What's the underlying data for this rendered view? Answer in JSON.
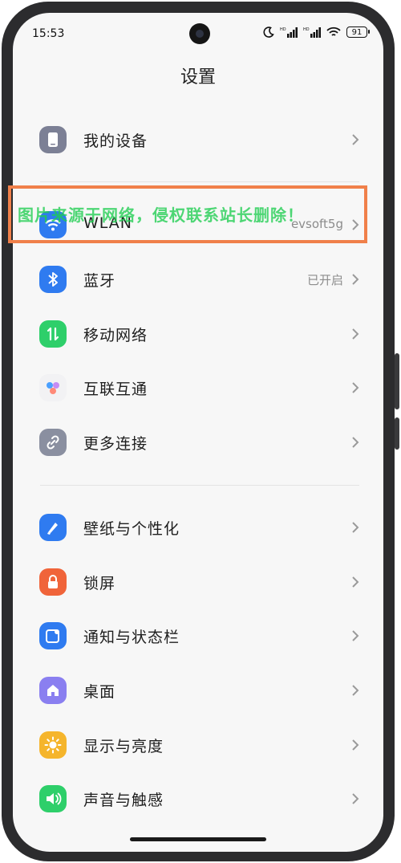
{
  "status_bar": {
    "time": "15:53",
    "signal_tag": "HD",
    "battery": "91"
  },
  "page": {
    "title": "设置"
  },
  "items": [
    {
      "label": "我的设备",
      "value": "",
      "icon": "phone-icon",
      "color": "#7c8095"
    },
    {
      "label": "WLAN",
      "value": "evsoft5g",
      "icon": "wifi-icon",
      "color": "#2f7bf0"
    },
    {
      "label": "蓝牙",
      "value": "已开启",
      "icon": "bluetooth-icon",
      "color": "#2f7bf0"
    },
    {
      "label": "移动网络",
      "value": "",
      "icon": "mobile-data-icon",
      "color": "#2ecf6a"
    },
    {
      "label": "互联互通",
      "value": "",
      "icon": "interconnect-icon",
      "color": "#f2f2f4"
    },
    {
      "label": "更多连接",
      "value": "",
      "icon": "link-icon",
      "color": "#8a8fa0"
    },
    {
      "label": "壁纸与个性化",
      "value": "",
      "icon": "wallpaper-icon",
      "color": "#2f7bf0"
    },
    {
      "label": "锁屏",
      "value": "",
      "icon": "lock-icon",
      "color": "#f0643a"
    },
    {
      "label": "通知与状态栏",
      "value": "",
      "icon": "notification-icon",
      "color": "#2f7bf0"
    },
    {
      "label": "桌面",
      "value": "",
      "icon": "home-icon",
      "color": "#8a7ff0"
    },
    {
      "label": "显示与亮度",
      "value": "",
      "icon": "brightness-icon",
      "color": "#f5b52c"
    },
    {
      "label": "声音与触感",
      "value": "",
      "icon": "sound-icon",
      "color": "#2ecf6a"
    }
  ],
  "overlay": {
    "watermark": "图片来源于网络，侵权联系站长删除！"
  }
}
